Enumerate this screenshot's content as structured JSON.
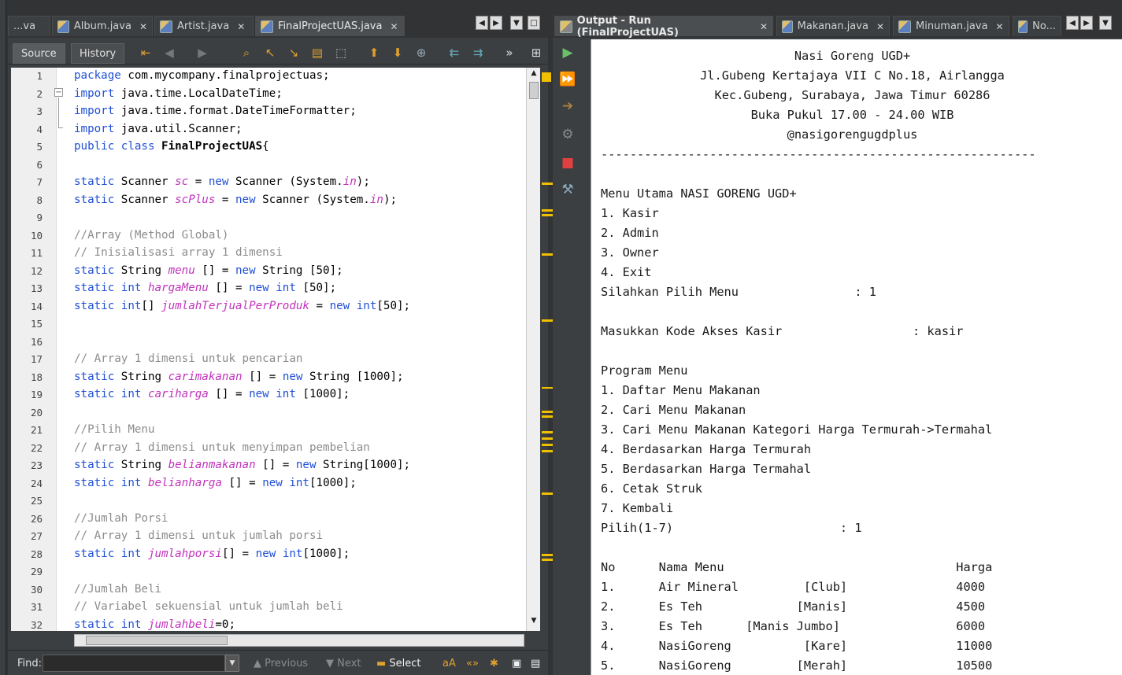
{
  "editor": {
    "tabs": [
      {
        "label": "...va",
        "icon": "java-file-icon"
      },
      {
        "label": "Album.java",
        "icon": "java-file-icon"
      },
      {
        "label": "Artist.java",
        "icon": "java-file-icon"
      },
      {
        "label": "FinalProjectUAS.java",
        "icon": "java-file-icon",
        "active": true
      }
    ],
    "source_label": "Source",
    "history_label": "History",
    "line_numbers": [
      "1",
      "2",
      "3",
      "4",
      "5",
      "6",
      "7",
      "8",
      "9",
      "10",
      "11",
      "12",
      "13",
      "14",
      "15",
      "16",
      "17",
      "18",
      "19",
      "20",
      "21",
      "22",
      "23",
      "24",
      "25",
      "26",
      "27",
      "28",
      "29",
      "30",
      "31",
      "32"
    ],
    "find": {
      "label": "Find:",
      "value": "",
      "previous": "Previous",
      "next": "Next",
      "select": "Select"
    }
  },
  "output": {
    "tabs": [
      {
        "label": "Output - Run (FinalProjectUAS)",
        "icon": "output-icon",
        "active": true
      },
      {
        "label": "Makanan.java",
        "icon": "java-file-icon"
      },
      {
        "label": "Minuman.java",
        "icon": "java-file-icon"
      },
      {
        "label": "No...",
        "icon": "java-file-icon"
      }
    ],
    "header": [
      "Nasi Goreng UGD+",
      "Jl.Gubeng Kertajaya VII C No.18, Airlangga",
      "Kec.Gubeng, Surabaya, Jawa Timur 60286",
      "Buka Pukul 17.00 - 24.00 WIB",
      "@nasigorengugdplus"
    ],
    "divider": "------------------------------------------------------------",
    "lines": [
      "Menu Utama NASI GORENG UGD+",
      "1. Kasir",
      "2. Admin",
      "3. Owner",
      "4. Exit",
      "Silahkan Pilih Menu                : 1",
      "",
      "Masukkan Kode Akses Kasir                  : kasir",
      "",
      "Program Menu",
      "1. Daftar Menu Makanan",
      "2. Cari Menu Makanan",
      "3. Cari Menu Makanan Kategori Harga Termurah->Termahal",
      "4. Berdasarkan Harga Termurah",
      "5. Berdasarkan Harga Termahal",
      "6. Cetak Struk",
      "7. Kembali",
      "Pilih(1-7)                       : 1",
      "",
      "No      Nama Menu                                Harga",
      "1.      Air Mineral         [Club]               4000",
      "2.      Es Teh             [Manis]               4500",
      "3.      Es Teh      [Manis Jumbo]                6000",
      "4.      NasiGoreng          [Kare]               11000",
      "5.      NasiGoreng         [Merah]               10500"
    ]
  }
}
